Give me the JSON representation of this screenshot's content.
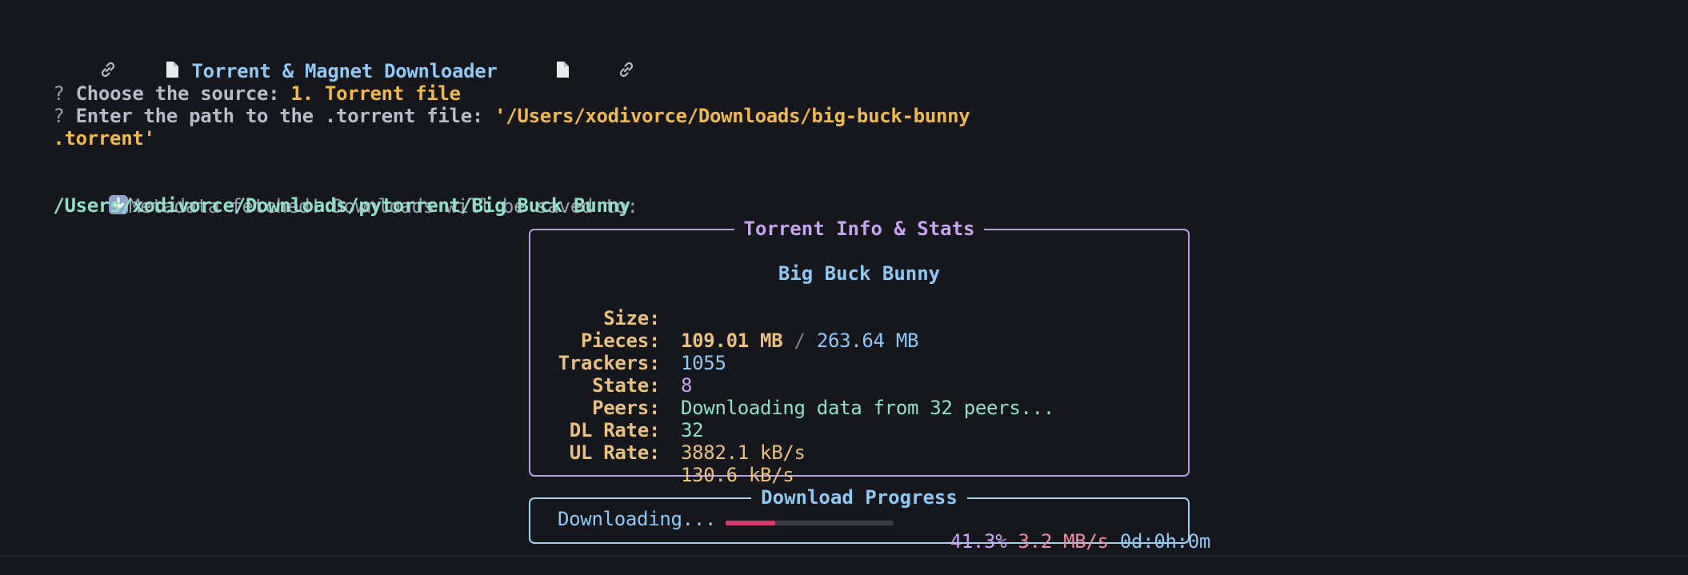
{
  "header": {
    "title": "Torrent & Magnet Downloader",
    "icon_left": "link-icon",
    "icon_right": "document-icon"
  },
  "prompts": [
    {
      "mark": "?",
      "question": "Choose the source:",
      "answer": "1. Torrent file"
    },
    {
      "mark": "?",
      "question": "Enter the path to the .torrent file:",
      "answer": "'/Users/xodivorce/Downloads/big-buck-bunny",
      "answer_cont": ".torrent'"
    }
  ],
  "metadata": {
    "message": "Metadata fetched! Downloads will be saved to:",
    "path": "/Users/xodivorce/Downloads/pytorrent/Big Buck Bunny",
    "icon": "download-arrow-icon"
  },
  "info_panel": {
    "title": "Torrent Info & Stats",
    "name": "Big Buck Bunny",
    "rows": {
      "size": {
        "label": "Size:",
        "downloaded": "109.01 MB",
        "sep": "/",
        "total": "263.64 MB"
      },
      "pieces": {
        "label": "Pieces:",
        "value": "1055"
      },
      "trackers": {
        "label": "Trackers:",
        "value": "8"
      },
      "state": {
        "label": "State:",
        "value": "Downloading data from 32 peers..."
      },
      "peers": {
        "label": "Peers:",
        "value": "32"
      },
      "dl_rate": {
        "label": "DL Rate:",
        "value": "3882.1 kB/s"
      },
      "ul_rate": {
        "label": "UL Rate:",
        "value": "130.6 kB/s"
      }
    }
  },
  "progress_panel": {
    "title": "Download Progress",
    "status": "Downloading...",
    "progress": 0.413,
    "percent": "41.3%",
    "speed": "3.2 MB/s",
    "eta": "0d:0h:0m"
  },
  "colors": {
    "background": "#16171d",
    "title_blue": "#8ec8f7",
    "answer_orange": "#f1b84c",
    "path_cyan": "#8fe0c6",
    "panel_purple": "#b59ee6",
    "panel_blue": "#9fd4f1",
    "bar_fill": "#e2386e",
    "label_tan": "#e9c07e"
  }
}
